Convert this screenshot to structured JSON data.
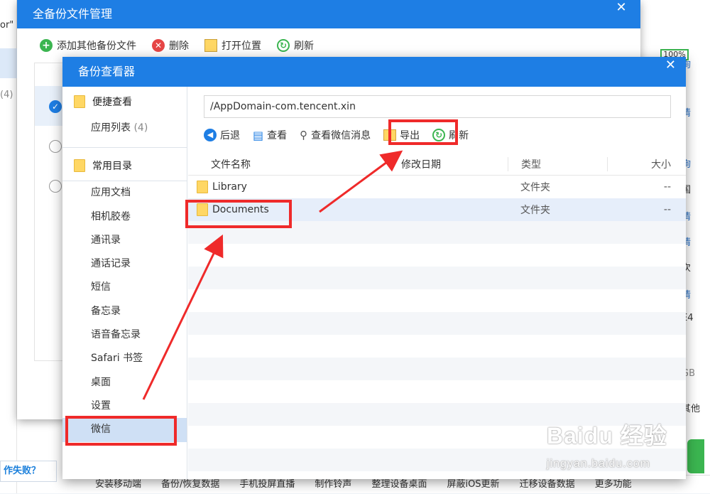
{
  "background": {
    "left_fragments": [
      "or\"",
      "(4)"
    ],
    "right_fragments": [
      "询",
      "情",
      "询",
      "国",
      "情",
      "情",
      "次",
      "情",
      "E4",
      "GB",
      "其他"
    ],
    "fail_button": "作失败？",
    "percent_badge": "100%",
    "bottom_bar": [
      "安装移动端",
      "备份/恢复数据",
      "手机投屏直播",
      "制作铃声",
      "整理设备桌面",
      "屏蔽iOS更新",
      "迁移设备数据",
      "更多功能"
    ]
  },
  "win1": {
    "title": "全备份文件管理",
    "close": "✕",
    "toolbar": {
      "add": "添加其他备份文件",
      "delete": "删除",
      "open_location": "打开位置",
      "refresh": "刷新"
    }
  },
  "win2": {
    "title": "备份查看器",
    "close": "✕",
    "sidebar": {
      "quick_group": "便捷查看",
      "app_list": "应用列表",
      "app_list_count": "(4)",
      "common_group": "常用目录",
      "items": [
        "应用文档",
        "相机胶卷",
        "通讯录",
        "通话记录",
        "短信",
        "备忘录",
        "语音备忘录",
        "Safari 书签",
        "桌面",
        "设置",
        "微信"
      ]
    },
    "path": "/AppDomain-com.tencent.xin",
    "toolbar": {
      "back": "后退",
      "view": "查看",
      "view_wechat": "查看微信消息",
      "export": "导出",
      "refresh": "刷新"
    },
    "table": {
      "headers": [
        "文件名称",
        "修改日期",
        "类型",
        "大小"
      ],
      "rows": [
        {
          "name": "Library",
          "date": "",
          "type": "文件夹",
          "size": "--"
        },
        {
          "name": "Documents",
          "date": "",
          "type": "文件夹",
          "size": "--"
        }
      ]
    }
  },
  "watermark": {
    "logo": "Baidu 经验",
    "url": "jingyan.baidu.com"
  },
  "colors": {
    "titlebar": "#1e7ee4",
    "annotation": "#ef2a2a",
    "selection": "#cfe0f5"
  }
}
